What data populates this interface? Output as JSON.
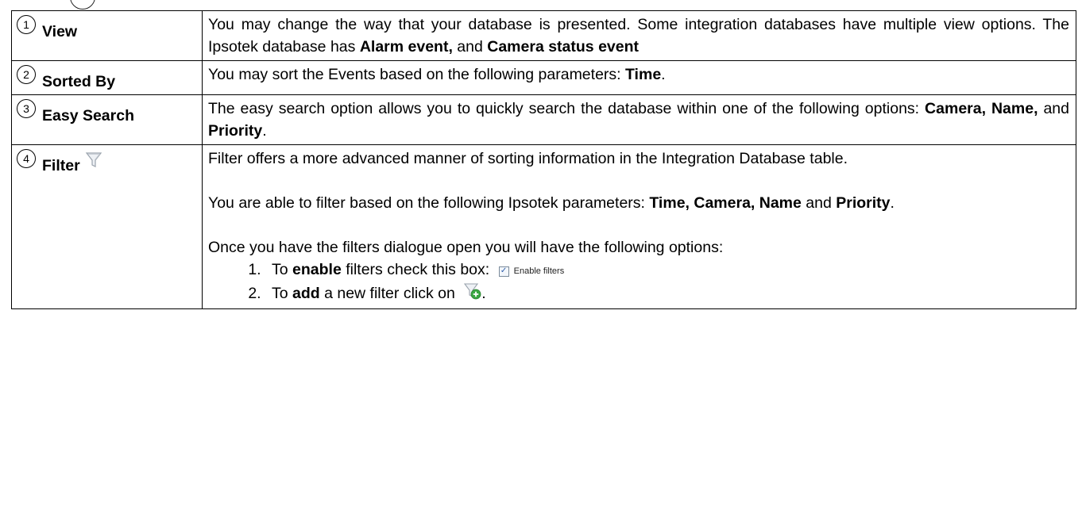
{
  "rows": [
    {
      "number": "1",
      "label": "View",
      "text": [
        {
          "t": "You may change the way that your database is presented. Some integration databases have multiple view options. The Ipsotek database has "
        },
        {
          "t": "Alarm event,",
          "b": true
        },
        {
          "t": " and "
        },
        {
          "t": "Camera status event",
          "b": true
        }
      ]
    },
    {
      "number": "2",
      "label": "Sorted By",
      "text": [
        {
          "t": "You may sort the Events based on the following parameters: "
        },
        {
          "t": "Time",
          "b": true
        },
        {
          "t": "."
        }
      ]
    },
    {
      "number": "3",
      "label": "Easy Search",
      "text": [
        {
          "t": "The easy search option allows you to quickly search the database within one of the following options: "
        },
        {
          "t": "Camera, Name,",
          "b": true
        },
        {
          "t": " and "
        },
        {
          "t": "Priority",
          "b": true
        },
        {
          "t": "."
        }
      ]
    },
    {
      "number": "4",
      "label": "Filter",
      "icon": "filter-icon",
      "para1": "Filter offers a more advanced manner of sorting information in the Integration Database table.",
      "para2": [
        {
          "t": "You are able to filter based on the following Ipsotek parameters: "
        },
        {
          "t": "Time, Camera, Name",
          "b": true
        },
        {
          "t": " and "
        },
        {
          "t": "Priority",
          "b": true
        },
        {
          "t": "."
        }
      ],
      "para3": "Once you have the filters dialogue open you will have the following options:",
      "steps": [
        {
          "parts": [
            {
              "t": "To "
            },
            {
              "t": "enable",
              "b": true
            },
            {
              "t": " filters check this box: "
            }
          ],
          "widget": "checkbox",
          "widget_label": "Enable filters",
          "after": ""
        },
        {
          "parts": [
            {
              "t": "To "
            },
            {
              "t": "add",
              "b": true
            },
            {
              "t": " a new filter click on "
            }
          ],
          "widget": "add-filter-icon",
          "after": "."
        }
      ]
    }
  ],
  "colors": {
    "border": "#000000",
    "filter_icon": "#c9ced6",
    "add_icon_green": "#3aa641"
  }
}
